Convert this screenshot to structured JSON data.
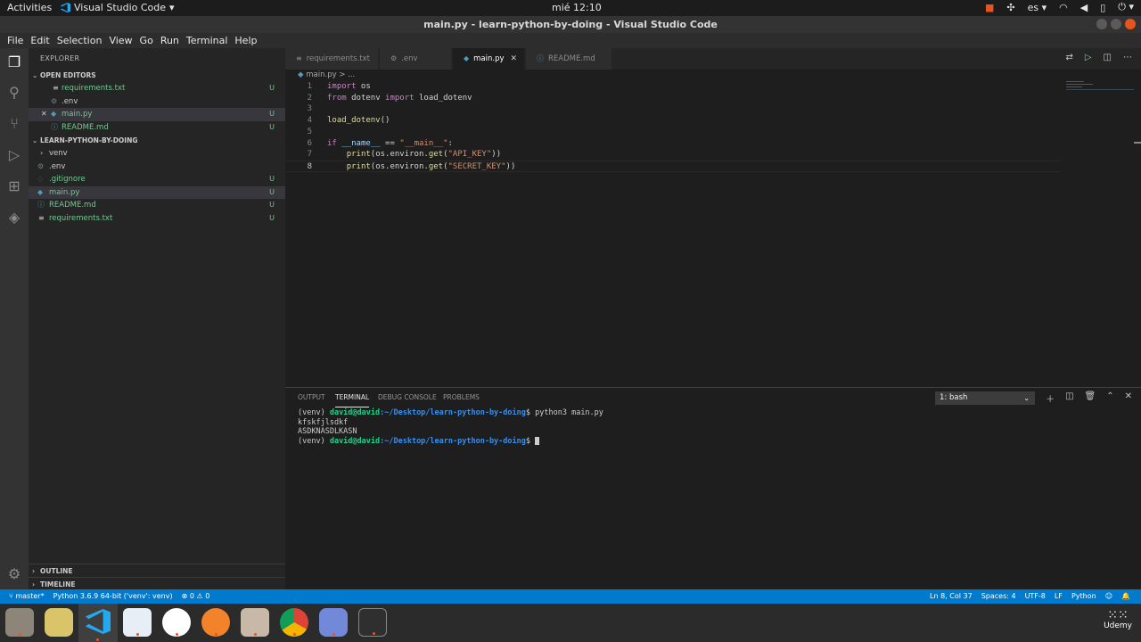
{
  "topbar": {
    "activities": "Activities",
    "app_name": "Visual Studio Code",
    "clock": "mié 12:10",
    "lang": "es"
  },
  "window": {
    "title": "main.py - learn-python-by-doing - Visual Studio Code"
  },
  "menu": [
    "File",
    "Edit",
    "Selection",
    "View",
    "Go",
    "Run",
    "Terminal",
    "Help"
  ],
  "sidebar": {
    "title": "EXPLORER",
    "open_editors_label": "OPEN EDITORS",
    "open_editors": [
      {
        "name": "requirements.txt",
        "badge": "U",
        "icon": "list-icon"
      },
      {
        "name": ".env",
        "badge": "",
        "icon": "gear-icon"
      },
      {
        "name": "main.py",
        "badge": "U",
        "icon": "python-icon"
      },
      {
        "name": "README.md",
        "badge": "U",
        "icon": "info-icon"
      }
    ],
    "project_label": "LEARN-PYTHON-BY-DOING",
    "files": [
      {
        "name": "venv",
        "badge": ""
      },
      {
        "name": ".env",
        "badge": ""
      },
      {
        "name": ".gitignore",
        "badge": "U"
      },
      {
        "name": "main.py",
        "badge": "U"
      },
      {
        "name": "README.md",
        "badge": "U"
      },
      {
        "name": "requirements.txt",
        "badge": "U"
      }
    ],
    "outline_label": "OUTLINE",
    "timeline_label": "TIMELINE"
  },
  "tabs": [
    {
      "label": "requirements.txt",
      "icon": "list-icon"
    },
    {
      "label": ".env",
      "icon": "gear-icon"
    },
    {
      "label": "main.py",
      "icon": "python-icon"
    },
    {
      "label": "README.md",
      "icon": "info-icon"
    }
  ],
  "breadcrumb": {
    "file": "main.py",
    "sep": "> ..."
  },
  "editor": {
    "line_numbers": [
      "1",
      "2",
      "3",
      "4",
      "5",
      "6",
      "7",
      "8"
    ],
    "l1": {
      "kw": "import",
      "rest": " os"
    },
    "l2": {
      "kw1": "from",
      "mid": " dotenv ",
      "kw2": "import",
      "rest": " load_dotenv"
    },
    "l4": {
      "fn": "load_dotenv",
      "rest": "()"
    },
    "l6": {
      "kw": "if",
      "var": "__name__",
      "op": " == ",
      "str": "\"__main__\"",
      "end": ":"
    },
    "l7": {
      "fn": "print",
      "a": "(os.environ.",
      "fn2": "get",
      "b": "(",
      "str": "\"API_KEY\"",
      "c": "))"
    },
    "l8": {
      "fn": "print",
      "a": "(os.environ.",
      "fn2": "get",
      "b": "(",
      "str": "\"SECRET_KEY\"",
      "c": "))"
    }
  },
  "panel": {
    "tabs": [
      "OUTPUT",
      "TERMINAL",
      "DEBUG CONSOLE",
      "PROBLEMS"
    ],
    "terminal_select": "1: bash",
    "terminal": {
      "venv": "(venv) ",
      "user": "david@david",
      "path": ":~/Desktop/learn-python-by-doing",
      "prompt": "$ ",
      "command": "python3 main.py",
      "out1": "kfskfjlsdkf",
      "out2": "ASDKNASDLKASN"
    }
  },
  "statusbar": {
    "branch": "master*",
    "python": "Python 3.6.9 64-bit ('venv': venv)",
    "problems": "⊗ 0 ⚠ 0",
    "position": "Ln 8, Col 37",
    "spaces": "Spaces: 4",
    "encoding": "UTF-8",
    "eol": "LF",
    "language": "Python"
  },
  "dock": [
    "files-app",
    "rhythmbox",
    "vscode",
    "writer",
    "slack",
    "drawing-app",
    "camera-app",
    "chrome",
    "discord",
    "terminal"
  ],
  "watermark": "Udemy"
}
